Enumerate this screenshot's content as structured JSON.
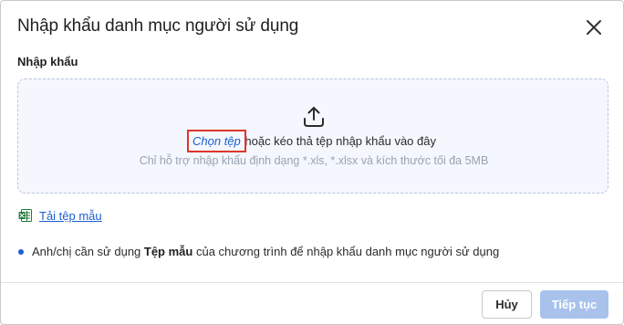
{
  "dialog": {
    "title": "Nhập khẩu danh mục người sử dụng",
    "close_icon": "close-icon"
  },
  "section": {
    "label": "Nhập khẩu"
  },
  "dropzone": {
    "icon": "upload-icon",
    "choose_file": "Chọn tệp",
    "drag_text": " hoặc kéo thả tệp nhập khẩu vào đây",
    "hint": "Chỉ hỗ trợ nhập khẩu định dạng *.xls, *.xlsx và kích thước tối đa 5MB"
  },
  "template": {
    "icon": "excel-icon",
    "link": "Tải tệp mẫu"
  },
  "note": {
    "before": "Anh/chị cần sử dụng ",
    "bold": "Tệp mẫu",
    "after": " của chương trình để nhập khẩu danh mục người sử dụng"
  },
  "footer": {
    "cancel_label": "Hủy",
    "next_label": "Tiếp tục"
  },
  "colors": {
    "accent": "#1a5fd1",
    "next_disabled": "#a8c2ec",
    "highlight_border": "#e0352b",
    "excel_green": "#1f7a3a"
  }
}
